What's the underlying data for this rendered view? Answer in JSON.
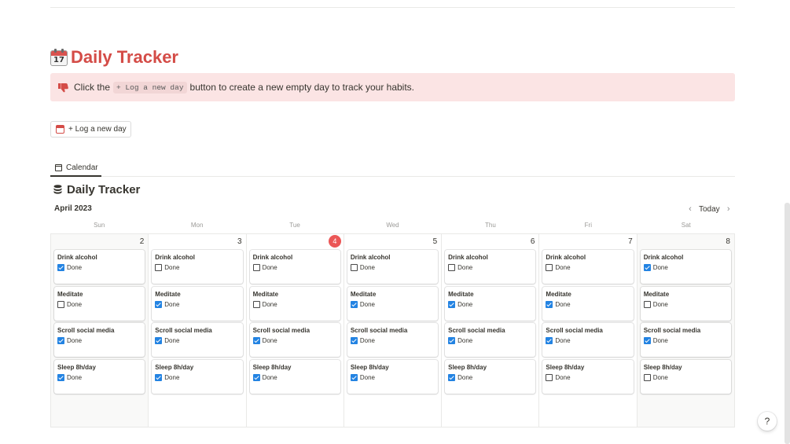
{
  "page": {
    "title": "Daily Tracker",
    "title_icon": "calendar-emoji-icon",
    "title_icon_text": "17",
    "accent_color": "#d44c47"
  },
  "callout": {
    "icon": "thumbs-down-icon",
    "text_before": "Click the",
    "code": "+ Log a new day",
    "text_after": "button to create a new empty day to track your habits.",
    "background": "#fbe4e4"
  },
  "log_button": {
    "label": "+ Log a new day",
    "icon": "calendar-icon"
  },
  "view_tab": {
    "label": "Calendar",
    "icon": "calendar-icon"
  },
  "database": {
    "title": "Daily Tracker",
    "icon": "database-icon"
  },
  "calendar": {
    "month_label": "April 2023",
    "today_label": "Today",
    "weekdays": [
      "Sun",
      "Mon",
      "Tue",
      "Wed",
      "Thu",
      "Fri",
      "Sat"
    ],
    "days": [
      {
        "num": "2",
        "today": false,
        "habits": [
          {
            "name": "Drink alcohol",
            "label": "Done",
            "checked": true
          },
          {
            "name": "Meditate",
            "label": "Done",
            "checked": false
          },
          {
            "name": "Scroll social media",
            "label": "Done",
            "checked": true
          },
          {
            "name": "Sleep 8h/day",
            "label": "Done",
            "checked": true
          }
        ]
      },
      {
        "num": "3",
        "today": false,
        "habits": [
          {
            "name": "Drink alcohol",
            "label": "Done",
            "checked": false
          },
          {
            "name": "Meditate",
            "label": "Done",
            "checked": true
          },
          {
            "name": "Scroll social media",
            "label": "Done",
            "checked": true
          },
          {
            "name": "Sleep 8h/day",
            "label": "Done",
            "checked": true
          }
        ]
      },
      {
        "num": "4",
        "today": true,
        "habits": [
          {
            "name": "Drink alcohol",
            "label": "Done",
            "checked": false
          },
          {
            "name": "Meditate",
            "label": "Done",
            "checked": false
          },
          {
            "name": "Scroll social media",
            "label": "Done",
            "checked": true
          },
          {
            "name": "Sleep 8h/day",
            "label": "Done",
            "checked": true
          }
        ]
      },
      {
        "num": "5",
        "today": false,
        "habits": [
          {
            "name": "Drink alcohol",
            "label": "Done",
            "checked": false
          },
          {
            "name": "Meditate",
            "label": "Done",
            "checked": true
          },
          {
            "name": "Scroll social media",
            "label": "Done",
            "checked": true
          },
          {
            "name": "Sleep 8h/day",
            "label": "Done",
            "checked": true
          }
        ]
      },
      {
        "num": "6",
        "today": false,
        "habits": [
          {
            "name": "Drink alcohol",
            "label": "Done",
            "checked": false
          },
          {
            "name": "Meditate",
            "label": "Done",
            "checked": true
          },
          {
            "name": "Scroll social media",
            "label": "Done",
            "checked": true
          },
          {
            "name": "Sleep 8h/day",
            "label": "Done",
            "checked": true
          }
        ]
      },
      {
        "num": "7",
        "today": false,
        "habits": [
          {
            "name": "Drink alcohol",
            "label": "Done",
            "checked": false
          },
          {
            "name": "Meditate",
            "label": "Done",
            "checked": true
          },
          {
            "name": "Scroll social media",
            "label": "Done",
            "checked": true
          },
          {
            "name": "Sleep 8h/day",
            "label": "Done",
            "checked": false
          }
        ]
      },
      {
        "num": "8",
        "today": false,
        "habits": [
          {
            "name": "Drink alcohol",
            "label": "Done",
            "checked": true
          },
          {
            "name": "Meditate",
            "label": "Done",
            "checked": false
          },
          {
            "name": "Scroll social media",
            "label": "Done",
            "checked": true
          },
          {
            "name": "Sleep 8h/day",
            "label": "Done",
            "checked": false
          }
        ]
      }
    ]
  },
  "help_button": {
    "label": "?"
  }
}
